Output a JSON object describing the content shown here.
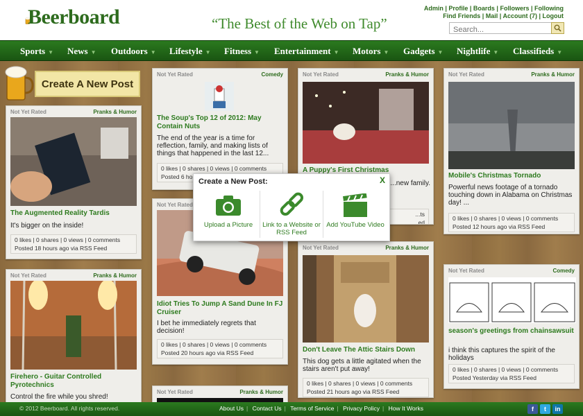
{
  "header": {
    "logo": "Beerboard",
    "tagline": "“The Best of the Web on Tap”",
    "links_row1": [
      "Admin",
      "Profile",
      "Boards",
      "Followers",
      "Following"
    ],
    "links_row2": [
      "Find Friends",
      "Mail",
      "Account (7)",
      "Logout"
    ],
    "search_placeholder": "Search..."
  },
  "nav": [
    "Sports",
    "News",
    "Outdoors",
    "Lifestyle",
    "Fitness",
    "Entertainment",
    "Motors",
    "Gadgets",
    "Nightlife",
    "Classifieds"
  ],
  "create_post": "Create A New Post",
  "cards": [
    {
      "rated": "Not Yet Rated",
      "category": "Pranks & Humor",
      "title": "The Augmented Reality Tardis",
      "desc": "It's bigger on the inside!",
      "stats": "0 likes | 0 shares | 0 views | 0 comments",
      "posted": "Posted 18 hours ago via RSS Feed"
    },
    {
      "rated": "Not Yet Rated",
      "category": "Pranks & Humor",
      "title": "Firehero - Guitar Controlled Pyrotechnics",
      "desc": "Control the fire while you shred!"
    },
    {
      "rated": "Not Yet Rated",
      "category": "Comedy",
      "title": "The Soup's Top 12 of 2012: May Contain Nuts",
      "desc": "The end of the year is a time for reflection, family, and making lists of things that happened in the last 12...",
      "stats": "0 likes | 0 shares | 0 views | 0 comments",
      "posted": "Posted 6 ho"
    },
    {
      "rated": "Not Yet Rated",
      "category": "",
      "title": "Idiot Tries To Jump A Sand Dune In FJ Cruiser",
      "desc": "I bet he immediately regrets that decision!",
      "stats": "0 likes | 0 shares | 0 views | 0 comments",
      "posted": "Posted 20 hours ago via RSS Feed"
    },
    {
      "rated": "Not Yet Rated",
      "category": "Pranks & Humor",
      "title": "A Puppy's First Christmas",
      "desc": "...ing a blast on ...new family.",
      "stats": "...ts",
      "posted": "...ed"
    },
    {
      "rated": "Not Yet Rated",
      "category": "Pranks & Humor",
      "title": "Don't Leave The Attic Stairs Down",
      "desc": "This dog gets a little agitated when the stairs aren't put away!",
      "stats": "0 likes | 0 shares | 0 views | 0 comments",
      "posted": "Posted 21 hours ago via RSS Feed"
    },
    {
      "rated": "Not Yet Rated",
      "category": "Pranks & Humor",
      "title": "Mobile's Christmas Tornado",
      "desc": "Powerful news footage of a tornado touching down in Alabama on Christmas day! ...",
      "stats": "0 likes | 0 shares | 0 views | 0 comments",
      "posted": "Posted 12 hours ago via RSS Feed"
    },
    {
      "rated": "Not Yet Rated",
      "category": "Comedy",
      "title": "season's greetings from chainsawsuit",
      "desc": "i think this captures the spirit of the holidays",
      "stats": "0 likes | 0 shares | 0 views | 0 comments",
      "posted": "Posted Yesterday via RSS Feed"
    },
    {
      "rated": "Not Yet Rated",
      "category": "Pranks & Humor"
    }
  ],
  "modal": {
    "title": "Create a New Post:",
    "close": "X",
    "options": [
      "Upload a Picture",
      "Link to a Website or RSS Feed",
      "Add YouTube Video"
    ]
  },
  "footer": {
    "copyright": "© 2012 Beerboard. All rights reserved.",
    "links": [
      "About Us",
      "Contact Us",
      "Terms of Service",
      "Privacy Policy",
      "How It Works"
    ]
  }
}
